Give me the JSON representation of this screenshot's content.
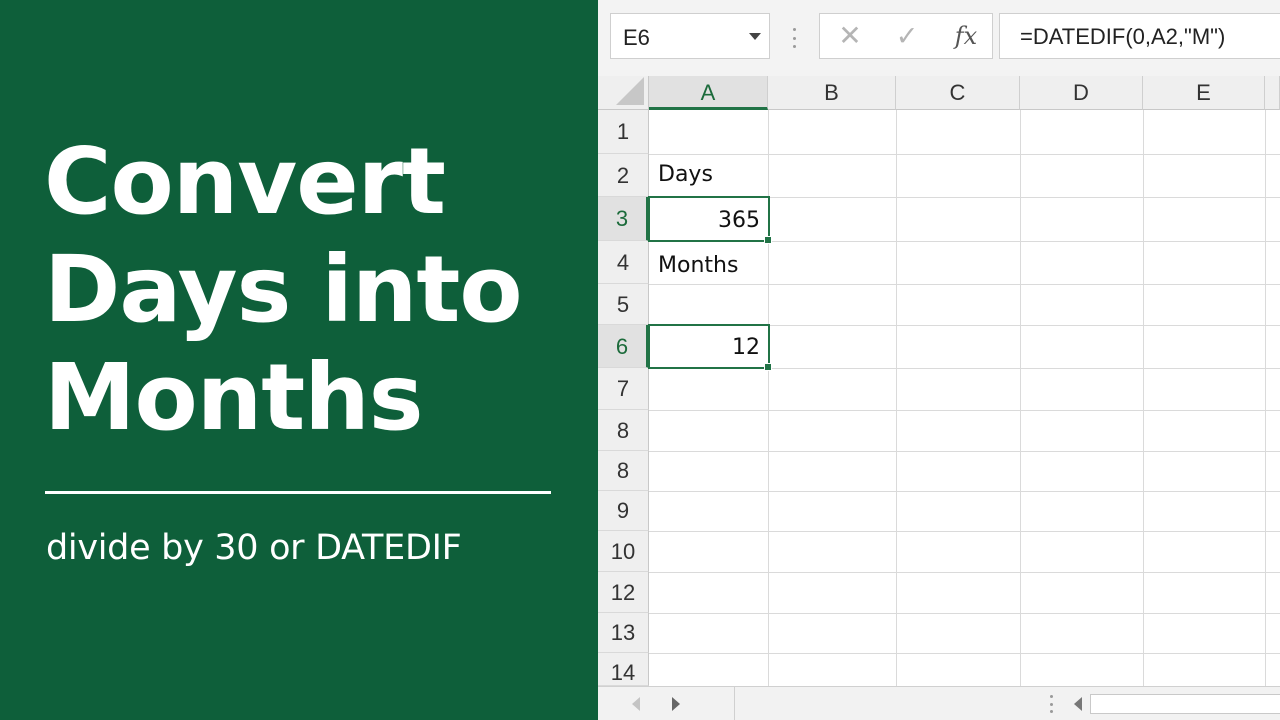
{
  "panel": {
    "title_lines": [
      "Convert",
      "Days into",
      "Months"
    ],
    "subtitle": "divide by 30 or DATEDIF",
    "background_color": "#0e5f3a"
  },
  "formula_bar": {
    "name_box": "E6",
    "cancel_icon": "✕",
    "enter_icon": "✓",
    "function_icon": "fx",
    "formula": "=DATEDIF(0,A2,\"M\")"
  },
  "columns": [
    "A",
    "B",
    "C",
    "D",
    "E"
  ],
  "rows": [
    "1",
    "2",
    "3",
    "4",
    "5",
    "6",
    "7",
    "8",
    "8",
    "9",
    "10",
    "12",
    "13",
    "14"
  ],
  "cells": {
    "a2": "Days",
    "a3": "365",
    "a4": "Months",
    "a6": "12"
  },
  "accent_color": "#217346"
}
